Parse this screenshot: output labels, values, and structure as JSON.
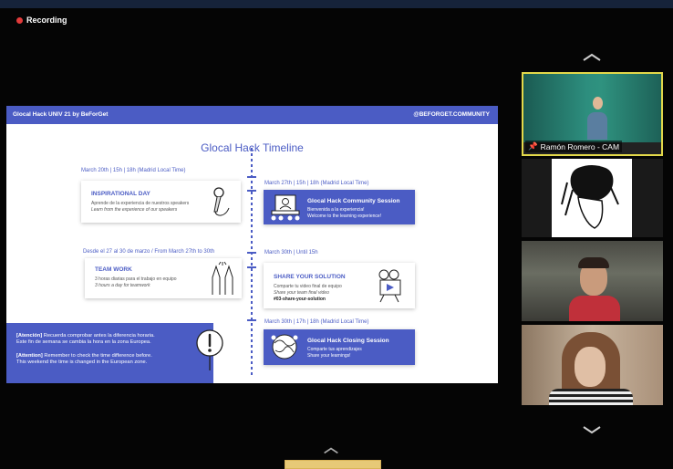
{
  "recording": {
    "label": "Recording"
  },
  "slide": {
    "header_left": "Glocal Hack UNIV 21 by BeForGet",
    "header_right": "@BEFORGET.COMMUNITY",
    "title": "Glocal Hack Timeline",
    "events": [
      {
        "date": "March 20th | 15h | 18h  (Madrid Local Time)",
        "title": "INSPIRATIONAL DAY",
        "line1": "Aprende de la experiencia de nuestros speakers",
        "line2": "Learn from the experience of our speakers",
        "icon": "microphone-icon"
      },
      {
        "date": "March 27th | 15h | 18h (Madrid Local Time)",
        "title": "Glocal Hack Community Session",
        "line1": "Bienvenida a la experiencia!",
        "line2": "Welcome to the learning experience!",
        "icon": "laptop-meeting-icon"
      },
      {
        "date": "Desde el 27 al 30 de marzo / From March 27th to 30th",
        "title": "TEAM WORK",
        "line1": "3 horas diarias para el trabajo en equipo",
        "line2": "3 hours a day for teamwork",
        "icon": "high-five-icon"
      },
      {
        "date": "March 30th | Until 15h",
        "title": "SHARE YOUR SOLUTION",
        "line1": "Comparte tu video final de equipo",
        "line2": "Share your team final video",
        "hashtag": "#03-share-your-solution",
        "icon": "video-camera-icon"
      },
      {
        "date": "March 30th | 17h | 18h (Madrid Local Time)",
        "title": "Glocal Hack Closing Session",
        "line1": "Comparte tus aprendizajes",
        "line2": "Share your learnings!",
        "icon": "globe-people-icon"
      }
    ],
    "notice": {
      "es_label": "[Atención]",
      "es_text": " Recuerda comprobar antes la diferencia horaria.",
      "es_text2": "Este fin de semana se cambia la hora en la zona Europea.",
      "en_label": "[Attention]",
      "en_text": " Remember to check the time difference before.",
      "en_text2": "This weekend the time is changed in the European zone.",
      "icon": "exclamation-sign-icon"
    }
  },
  "participants": [
    {
      "name": "Ramón Romero - CAM",
      "active": true,
      "icon": "pin-icon"
    },
    {
      "name": "",
      "avatar": "native-headdress-logo"
    },
    {
      "name": ""
    },
    {
      "name": ""
    }
  ],
  "colors": {
    "accent": "#4b5cc4",
    "active_speaker": "#e3d84a",
    "record": "#e23b3b"
  }
}
